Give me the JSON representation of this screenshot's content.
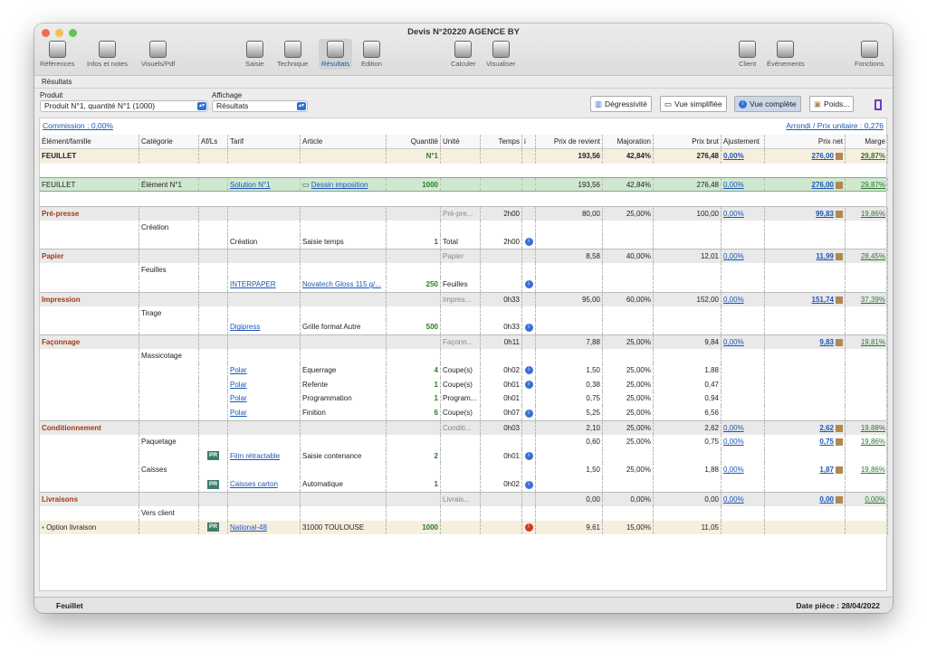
{
  "window": {
    "title": "Devis N°20220 AGENCE BY"
  },
  "toolbar": [
    {
      "label": "Références",
      "icon": "info-icon"
    },
    {
      "label": "Infos et notes",
      "icon": "notes-icon"
    },
    {
      "label": "Visuels/Pdf",
      "icon": "eye-icon"
    },
    {
      "label": "Saisie",
      "icon": "edit-icon"
    },
    {
      "label": "Technique",
      "icon": "technique-icon"
    },
    {
      "label": "Résultats",
      "icon": "calculator-icon"
    },
    {
      "label": "Edition",
      "icon": "print-icon"
    },
    {
      "label": "Calculer",
      "icon": "grid-icon"
    },
    {
      "label": "Visualiser",
      "icon": "eye-icon"
    },
    {
      "label": "Client",
      "icon": "client-icon"
    },
    {
      "label": "Événements",
      "icon": "events-icon"
    },
    {
      "label": "Fonctions",
      "icon": "gear-icon"
    }
  ],
  "breadcrumb": "Résultats",
  "controls": {
    "produit_label": "Produit",
    "produit_value": "Produit N°1, quantité N°1 (1000)",
    "affichage_label": "Affichage",
    "affichage_value": "Résultats",
    "btn_degressivite": "Dégressivité",
    "btn_vue_simplifiee": "Vue simplifiée",
    "btn_vue_complete": "Vue complète",
    "btn_poids": "Poids..."
  },
  "links": {
    "commission": "Commission : 0,00%",
    "arrondi": "Arrondi / Prix unitaire : 0,276"
  },
  "columns": [
    "Élément/famille",
    "Catégorie",
    "Af/Ls",
    "Tarif",
    "Article",
    "Quantité",
    "Unité",
    "Temps",
    "i",
    "Prix de revient",
    "Majoration",
    "Prix brut",
    "Ajustement",
    "Prix net",
    "Marge"
  ],
  "rows": [
    {
      "t": "feu",
      "c": [
        "FEUILLET",
        "",
        "",
        "",
        "",
        "N°1",
        "",
        "",
        "",
        "193,56",
        "42,84%",
        "276,48",
        "0,00%",
        "276,00",
        "29,87%"
      ]
    },
    {
      "t": "blank",
      "c": []
    },
    {
      "t": "green",
      "c": [
        "FEUILLET",
        "Élément N°1",
        "",
        "Solution N°1",
        "Dessin imposition",
        "1000",
        "",
        "",
        "",
        "193,56",
        "42,84%",
        "276,48",
        "0,00%",
        "276,00",
        "29,87%"
      ]
    },
    {
      "t": "blank",
      "c": []
    },
    {
      "t": "sec",
      "c": [
        "Pré-presse",
        "",
        "",
        "",
        "",
        "",
        "Pré-pre...",
        "2h00",
        "",
        "80,00",
        "25,00%",
        "100,00",
        "0,00%",
        "99,83",
        "19,86%"
      ]
    },
    {
      "t": "sub",
      "c": [
        "",
        "Création",
        "",
        "",
        "",
        "",
        "",
        "",
        "",
        "",
        "",
        "",
        "",
        "",
        ""
      ]
    },
    {
      "t": "det",
      "c": [
        "",
        "",
        "",
        "Création",
        "Saisie temps",
        "1",
        "Total",
        "2h00",
        "i",
        "",
        "",
        "",
        "",
        "",
        ""
      ]
    },
    {
      "t": "sec",
      "c": [
        "Papier",
        "",
        "",
        "",
        "",
        "",
        "Papier",
        "",
        "",
        "8,58",
        "40,00%",
        "12,01",
        "0,00%",
        "11,99",
        "28,45%"
      ]
    },
    {
      "t": "sub",
      "c": [
        "",
        "Feuilles",
        "",
        "",
        "",
        "",
        "",
        "",
        "",
        "",
        "",
        "",
        "",
        "",
        ""
      ]
    },
    {
      "t": "det",
      "c": [
        "",
        "",
        "",
        "INTERPAPER",
        "Novatech Gloss 115 g/...",
        "250",
        "Feuilles",
        "",
        "i",
        "",
        "",
        "",
        "",
        "",
        ""
      ]
    },
    {
      "t": "sec",
      "c": [
        "Impression",
        "",
        "",
        "",
        "",
        "",
        "Impres...",
        "0h33",
        "",
        "95,00",
        "60,00%",
        "152,00",
        "0,00%",
        "151,74",
        "37,39%"
      ]
    },
    {
      "t": "sub",
      "c": [
        "",
        "Tirage",
        "",
        "",
        "",
        "",
        "",
        "",
        "",
        "",
        "",
        "",
        "",
        "",
        ""
      ]
    },
    {
      "t": "det",
      "c": [
        "",
        "",
        "",
        "Digipress",
        "Grille format Autre",
        "500",
        "",
        "0h33",
        "i",
        "",
        "",
        "",
        "",
        "",
        ""
      ]
    },
    {
      "t": "sec",
      "c": [
        "Façonnage",
        "",
        "",
        "",
        "",
        "",
        "Façonn...",
        "0h11",
        "",
        "7,88",
        "25,00%",
        "9,84",
        "0,00%",
        "9,83",
        "19,81%"
      ]
    },
    {
      "t": "sub",
      "c": [
        "",
        "Massicotage",
        "",
        "",
        "",
        "",
        "",
        "",
        "",
        "",
        "",
        "",
        "",
        "",
        ""
      ]
    },
    {
      "t": "det",
      "c": [
        "",
        "",
        "",
        "Polar",
        "Equerrage",
        "4",
        "Coupe(s)",
        "0h02",
        "i",
        "1,50",
        "25,00%",
        "1,88",
        "",
        "",
        ""
      ]
    },
    {
      "t": "det",
      "c": [
        "",
        "",
        "",
        "Polar",
        "Refente",
        "1",
        "Coupe(s)",
        "0h01",
        "i",
        "0,38",
        "25,00%",
        "0,47",
        "",
        "",
        ""
      ]
    },
    {
      "t": "det",
      "c": [
        "",
        "",
        "",
        "Polar",
        "Programmation",
        "1",
        "Program...",
        "0h01",
        "",
        "0,75",
        "25,00%",
        "0,94",
        "",
        "",
        ""
      ]
    },
    {
      "t": "det",
      "c": [
        "",
        "",
        "",
        "Polar",
        "Finition",
        "6",
        "Coupe(s)",
        "0h07",
        "i",
        "5,25",
        "25,00%",
        "6,56",
        "",
        "",
        ""
      ]
    },
    {
      "t": "sec",
      "c": [
        "Conditionnement",
        "",
        "",
        "",
        "",
        "",
        "Conditi...",
        "0h03",
        "",
        "2,10",
        "25,00%",
        "2,62",
        "0,00%",
        "2,62",
        "19,88%"
      ]
    },
    {
      "t": "sub",
      "c": [
        "",
        "Paquetage",
        "",
        "",
        "",
        "",
        "",
        "",
        "",
        "0,60",
        "25,00%",
        "0,75",
        "0,00%",
        "0,75",
        "19,86%"
      ]
    },
    {
      "t": "det",
      "c": [
        "",
        "",
        "PR",
        "Film rétractable",
        "Saisie contenance",
        "2",
        "",
        "0h01",
        "i",
        "",
        "",
        "",
        "",
        "",
        ""
      ]
    },
    {
      "t": "sub",
      "c": [
        "",
        "Caisses",
        "",
        "",
        "",
        "",
        "",
        "",
        "",
        "1,50",
        "25,00%",
        "1,88",
        "0,00%",
        "1,87",
        "19,86%"
      ]
    },
    {
      "t": "det",
      "c": [
        "",
        "",
        "PR",
        "Caisses carton",
        "Automatique",
        "1",
        "",
        "0h02",
        "i",
        "",
        "",
        "",
        "",
        "",
        ""
      ]
    },
    {
      "t": "sec",
      "c": [
        "Livraisons",
        "",
        "",
        "",
        "",
        "",
        "Livrais...",
        "",
        "",
        "0,00",
        "0,00%",
        "0,00",
        "0,00%",
        "0,00",
        "0,00%"
      ]
    },
    {
      "t": "sub",
      "c": [
        "",
        "Vers client",
        "",
        "",
        "",
        "",
        "",
        "",
        "",
        "",
        "",
        "",
        "",
        "",
        ""
      ]
    },
    {
      "t": "liv",
      "c": [
        "Option livraison",
        "",
        "PR",
        "National-48",
        "31000 TOULOUSE",
        "1000",
        "",
        "",
        "!",
        "9,61",
        "15,00%",
        "11,05",
        "",
        "",
        ""
      ]
    }
  ],
  "footer": {
    "left": "Feuillet",
    "right": "Date pièce : 28/04/2022"
  },
  "colors": {
    "accent": "#1a57b8",
    "section": "#a03a1a",
    "green_row": "#cfe8cf",
    "feuillet_row": "#f6efdf"
  }
}
